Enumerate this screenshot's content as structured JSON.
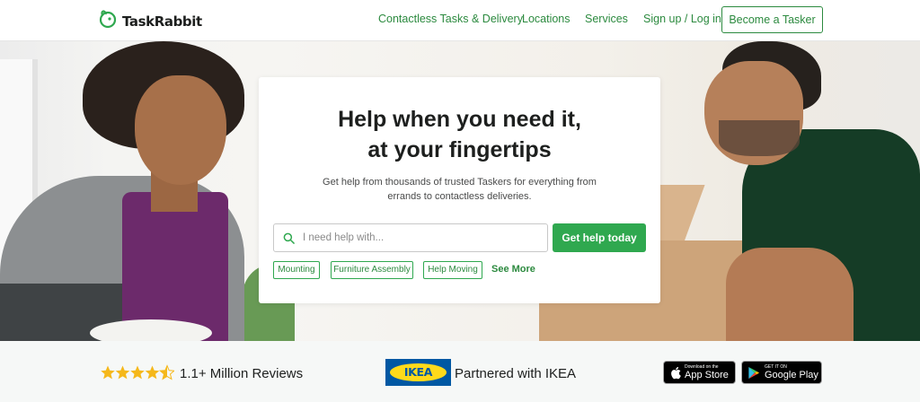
{
  "header": {
    "brand": "TaskRabbit",
    "nav": [
      {
        "label": "Contactless Tasks & Delivery"
      },
      {
        "label": "Locations"
      },
      {
        "label": "Services"
      },
      {
        "label": "Sign up / Log in"
      }
    ],
    "cta_label": "Become a Tasker"
  },
  "hero": {
    "headline_line1": "Help when you need it,",
    "headline_line2": "at your fingertips",
    "subtext_line1": "Get help from thousands of trusted Taskers for everything from",
    "subtext_line2": "errands to contactless deliveries.",
    "search": {
      "placeholder": "I need help with...",
      "value": ""
    },
    "cta_label": "Get help today",
    "chips": [
      {
        "label": "Mounting"
      },
      {
        "label": "Furniture Assembly"
      },
      {
        "label": "Help Moving"
      }
    ],
    "see_more": "See More"
  },
  "trust": {
    "rating_stars": 4.5,
    "reviews_label": "1.1+ Million Reviews",
    "ikea_logo": "IKEA",
    "ikea_label": "Partnered with IKEA",
    "app_store": {
      "small": "Download on the",
      "big": "App Store"
    },
    "google_play": {
      "small": "GET IT ON",
      "big": "Google Play"
    }
  },
  "colors": {
    "brand_green": "#2c8a3f",
    "cta_green": "#2fa84f",
    "ikea_blue": "#0058a3",
    "ikea_yellow": "#ffda1a",
    "star_yellow": "#f5b81b"
  },
  "icons": [
    "rabbit-logo-icon",
    "search-icon",
    "star-icon",
    "apple-icon",
    "google-play-icon"
  ]
}
